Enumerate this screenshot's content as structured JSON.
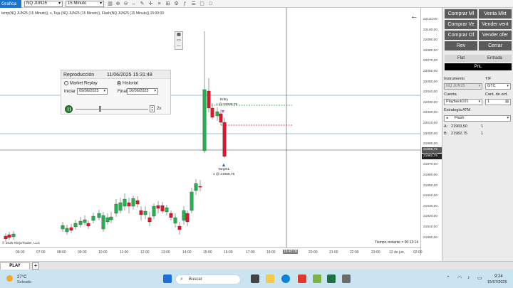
{
  "toolbar": {
    "app_title": "Grafica",
    "instrument": "NQ JUN25",
    "timeframe": "15 Minuto"
  },
  "chart": {
    "header": "temp(NQ JUN25 (15 Minuto)), s, Teja (NQ JUN25 (15 Minuto)), Flash(NQ JUN25 (15 Minuto)),15:00:00",
    "price_labels": [
      "22110,00",
      "22100,00",
      "22090,00",
      "22080,00",
      "22070,00",
      "22060,00",
      "22050,00",
      "22040,00",
      "22030,00",
      "22020,00",
      "22010,00",
      "22000,00",
      "21990,00",
      "21980,00",
      "21970,00",
      "21960,00",
      "21950,00",
      "21940,00",
      "21930,00",
      "21920,00",
      "21910,00",
      "21900,00"
    ],
    "current_price_a": "21988,75",
    "current_price_b": "21982,75",
    "time_labels": [
      "06:00",
      "07:00",
      "08:00",
      "09:00",
      "10:00",
      "11:00",
      "12:00",
      "13:00",
      "14:00",
      "15:00",
      "16:00",
      "17:00",
      "18:00",
      "18:45:00",
      "20:00",
      "21:00",
      "22:00",
      "23:00",
      "12 de jun.",
      "02:00"
    ],
    "entry_label": "Entry",
    "entry_detail": "1 @ 22005,75",
    "target_label": "Target1",
    "target_detail": "1 @ 21969,75",
    "copyright": "© 2025 NinjaTrader, LLC",
    "remaining_time": "Tiempo restante = 00:13:14",
    "colors": {
      "up": "#22b14c",
      "down": "#e0162b",
      "entry": "#1a9c2a",
      "stop": "#e0162b",
      "hline": "#7aa7d9"
    }
  },
  "replay": {
    "title": "Reproducción",
    "datetime": "11/06/2025 15:31:48",
    "option_market": "Market Replay",
    "option_hist": "Historial",
    "start_label": "Iniciar",
    "start_value": "09/06/2025",
    "end_label": "Final",
    "end_value": "16/06/2025",
    "speed": "2x"
  },
  "order_panel": {
    "btn_buy_mkt": "Comprar Ml",
    "btn_sell_mkt": "Venta Mkt",
    "btn_buy_bid": "Comprar Ve",
    "btn_sell_bid": "Vender vent",
    "btn_buy_offer": "Comprar Of",
    "btn_sell_offer": "Vender ofer",
    "btn_rev": "Rev",
    "btn_close": "Cerrar",
    "flat": "Flat",
    "entry": "Entrada",
    "pnl": "PnL",
    "instrument_label": "Instrumento",
    "instrument_value": "NQ JUN25",
    "tif_label": "TIF",
    "tif_value": "GTC",
    "account_label": "Cuenta",
    "account_value": "Playback101",
    "qty_label": "Cant. de ord.",
    "qty_value": "1",
    "atm_label": "Estrategia ATM",
    "atm_value": "Flash",
    "a_label": "A:",
    "a_price": "21983,50",
    "a_qty": "1",
    "b_label": "B:",
    "b_price": "21982,75",
    "b_qty": "1"
  },
  "tabs": {
    "play": "PLAY",
    "add": "+"
  },
  "taskbar": {
    "temp": "27°C",
    "condition": "Soleado",
    "search": "Buscar",
    "time": "9:24",
    "date": "15/07/2025"
  }
}
